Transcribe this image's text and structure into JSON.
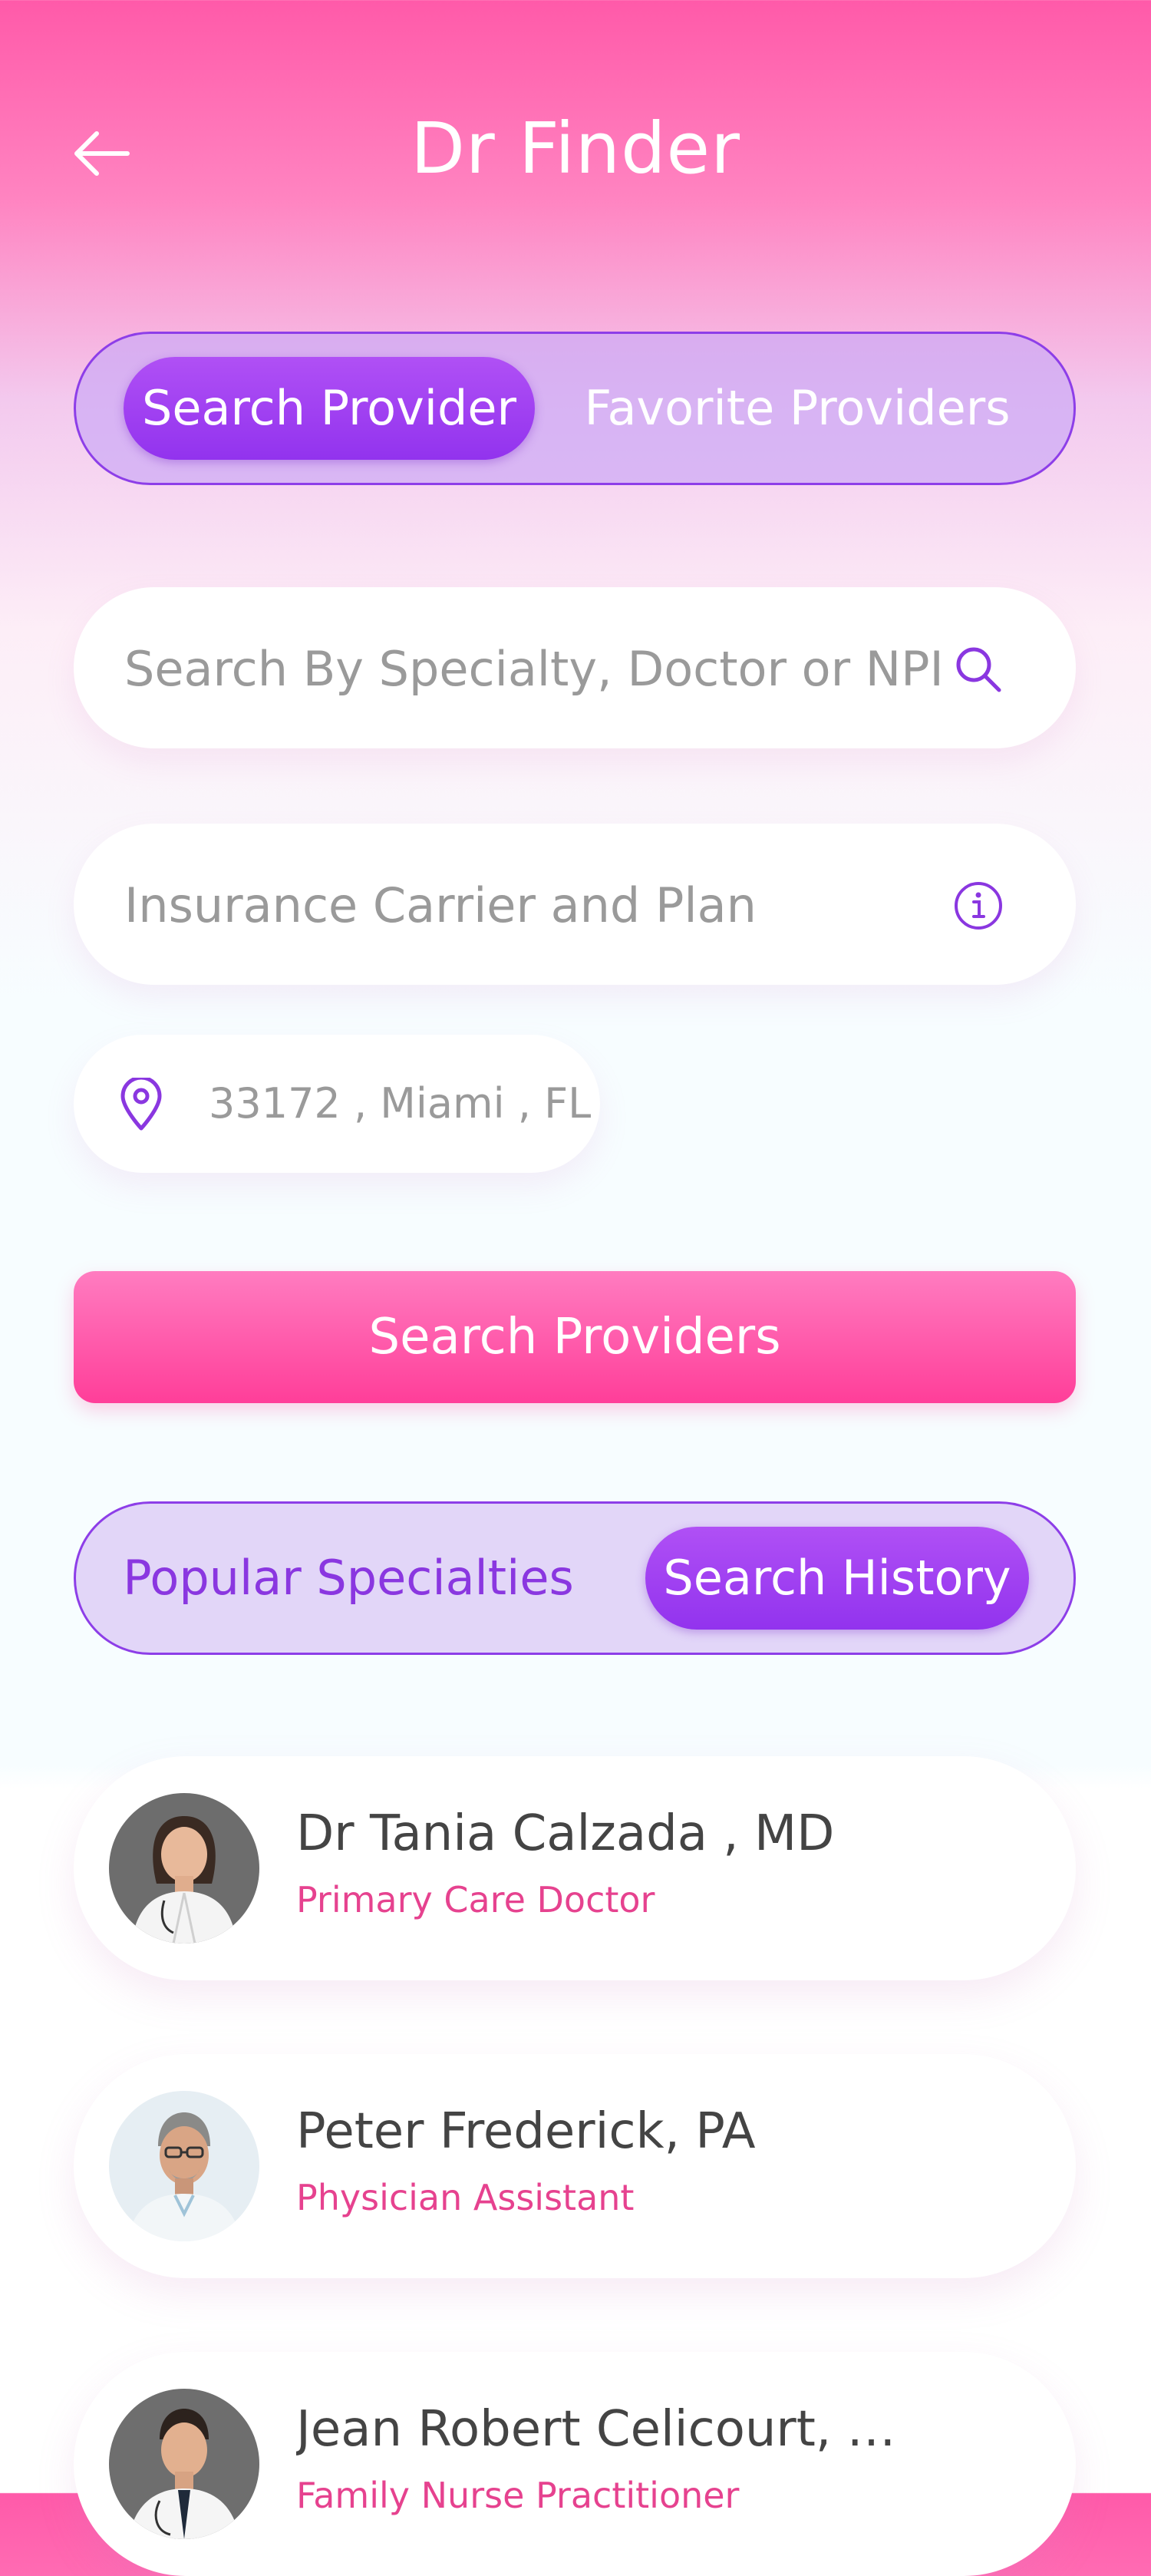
{
  "header": {
    "title": "Dr Finder",
    "back_icon": "arrow-left-icon"
  },
  "provider_tabs": {
    "items": [
      "Search Provider",
      "Favorite Providers"
    ],
    "active": 0
  },
  "search": {
    "placeholder": "Search By Specialty, Doctor or NPI",
    "icon": "search-icon"
  },
  "insurance": {
    "placeholder": "Insurance Carrier and Plan",
    "icon": "info-icon"
  },
  "location": {
    "value": "33172 , Miami , FL",
    "icon": "location-pin-icon"
  },
  "search_button": {
    "label": "Search Providers"
  },
  "specialty_tabs": {
    "items": [
      "Popular Specialties",
      "Search History"
    ],
    "active": 1
  },
  "providers": [
    {
      "name": "Dr Tania Calzada , MD",
      "specialty": "Primary Care Doctor"
    },
    {
      "name": "Peter Frederick, PA",
      "specialty": "Physician Assistant"
    },
    {
      "name": "Jean Robert Celicourt, A...",
      "specialty": "Family Nurse Practitioner"
    }
  ],
  "colors": {
    "accent_pink": "#ff3e99",
    "accent_purple": "#9233ee",
    "specialty_text": "#e6428f"
  }
}
